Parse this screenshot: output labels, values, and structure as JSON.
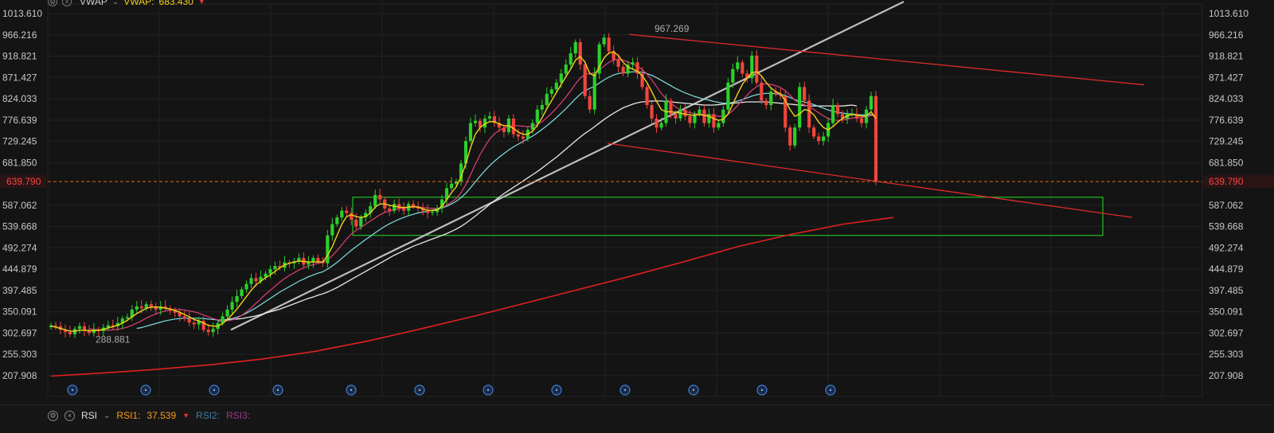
{
  "header": {
    "indicator_name": "VWAP",
    "vwap_label": "VWAP:",
    "vwap_value": "683.430"
  },
  "footer": {
    "indicator_name": "RSI",
    "rsi1_label": "RSI1:",
    "rsi1_value": "37.539",
    "rsi2_label": "RSI2:",
    "rsi3_label": "RSI3:"
  },
  "colors": {
    "background": "#141414",
    "grid": "#222222",
    "up_candle": "#2bd12b",
    "down_candle": "#f2453d",
    "ma_short": "#f2d21b",
    "ma_mid": "#e0407a",
    "ma_long": "#7fe0e0",
    "ma_longer": "#e8e8e8",
    "ma_slowest": "#e22020",
    "channel_line": "#e02a2a",
    "trendline": "#bdbdbd",
    "zone": "#22c022",
    "current_price_line": "#e06a1a"
  },
  "chart_data": {
    "type": "candlestick",
    "y_ticks": [
      "1013.610",
      "966.216",
      "918.821",
      "871.427",
      "824.033",
      "776.639",
      "729.245",
      "681.850",
      "587.062",
      "539.668",
      "492.274",
      "444.879",
      "397.485",
      "350.091",
      "302.697",
      "255.303",
      "207.908"
    ],
    "ylim": [
      207.908,
      1013.61
    ],
    "current_price": "639.790",
    "annotations": {
      "high_label": "967.269",
      "low_label": "288.881"
    },
    "event_marker_count": 12,
    "event_marker_icon": "clock-icon",
    "candle_closes": [
      320,
      318,
      310,
      305,
      300,
      312,
      318,
      308,
      303,
      311,
      307,
      315,
      320,
      318,
      325,
      335,
      338,
      355,
      362,
      358,
      367,
      360,
      355,
      362,
      358,
      352,
      348,
      340,
      335,
      326,
      322,
      330,
      310,
      305,
      312,
      325,
      340,
      355,
      372,
      385,
      400,
      412,
      425,
      418,
      428,
      435,
      445,
      452,
      448,
      460,
      458,
      462,
      470,
      455,
      460,
      470,
      462,
      458,
      520,
      545,
      560,
      575,
      570,
      555,
      540,
      560,
      570,
      585,
      610,
      600,
      580,
      575,
      590,
      580,
      575,
      590,
      585,
      580,
      575,
      570,
      572,
      580,
      600,
      625,
      635,
      640,
      680,
      730,
      770,
      775,
      760,
      780,
      785,
      770,
      760,
      750,
      780,
      745,
      740,
      735,
      755,
      770,
      800,
      810,
      835,
      845,
      860,
      880,
      900,
      925,
      950,
      900,
      830,
      800,
      880,
      945,
      960,
      930,
      910,
      895,
      880,
      900,
      905,
      880,
      850,
      810,
      780,
      760,
      770,
      820,
      790,
      780,
      800,
      785,
      770,
      790,
      800,
      770,
      790,
      760,
      770,
      800,
      860,
      890,
      905,
      880,
      870,
      920,
      860,
      820,
      810,
      840,
      835,
      830,
      760,
      720,
      760,
      850,
      820,
      760,
      740,
      730,
      740,
      770,
      810,
      790,
      780,
      790,
      790,
      780,
      770,
      800,
      830,
      640
    ],
    "ma_short": [
      318,
      316,
      313,
      310,
      307,
      307,
      309,
      309,
      308,
      308,
      309,
      311,
      314,
      317,
      320,
      325,
      331,
      339,
      346,
      352,
      358,
      360,
      361,
      360,
      358,
      356,
      353,
      349,
      344,
      339,
      333,
      330,
      325,
      320,
      318,
      318,
      324,
      333,
      344,
      356,
      370,
      384,
      398,
      410,
      418,
      426,
      432,
      440,
      448,
      454,
      458,
      461,
      463,
      462,
      461,
      461,
      461,
      461,
      475,
      495,
      520,
      545,
      562,
      566,
      562,
      560,
      562,
      570,
      583,
      590,
      590,
      587,
      585,
      583,
      582,
      583,
      584,
      583,
      579,
      576,
      575,
      577,
      585,
      600,
      615,
      628,
      650,
      680,
      715,
      745,
      760,
      768,
      773,
      773,
      768,
      764,
      764,
      758,
      750,
      745,
      745,
      752,
      765,
      782,
      802,
      820,
      838,
      856,
      873,
      890,
      910,
      918,
      905,
      880,
      875,
      895,
      915,
      926,
      928,
      920,
      905,
      895,
      890,
      885,
      875,
      860,
      840,
      818,
      800,
      795,
      795,
      794,
      792,
      790,
      788,
      787,
      789,
      787,
      785,
      780,
      776,
      778,
      790,
      812,
      835,
      856,
      870,
      882,
      884,
      875,
      860,
      848,
      840,
      835,
      820,
      800,
      785,
      790,
      800,
      798,
      788,
      772,
      760,
      755,
      762,
      772,
      780,
      786,
      789,
      788,
      785,
      786,
      795,
      780
    ],
    "ma_mid": [
      null,
      null,
      null,
      null,
      null,
      null,
      null,
      null,
      312,
      311,
      310,
      309,
      309,
      310,
      311,
      313,
      316,
      320,
      325,
      330,
      336,
      341,
      345,
      349,
      352,
      354,
      355,
      355,
      354,
      352,
      350,
      347,
      343,
      339,
      335,
      332,
      330,
      330,
      332,
      336,
      342,
      350,
      359,
      369,
      379,
      389,
      398,
      407,
      416,
      424,
      431,
      437,
      443,
      448,
      452,
      455,
      458,
      460,
      466,
      475,
      486,
      499,
      512,
      523,
      531,
      538,
      545,
      552,
      559,
      566,
      571,
      574,
      577,
      579,
      581,
      582,
      583,
      583,
      582,
      581,
      580,
      580,
      582,
      587,
      594,
      602,
      615,
      633,
      655,
      678,
      700,
      718,
      734,
      746,
      754,
      759,
      763,
      764,
      764,
      763,
      762,
      763,
      767,
      773,
      782,
      792,
      803,
      815,
      828,
      842,
      857,
      870,
      878,
      880,
      882,
      888,
      897,
      905,
      910,
      912,
      910,
      906,
      901,
      896,
      889,
      879,
      866,
      851,
      836,
      824,
      814,
      806,
      800,
      796,
      793,
      791,
      790,
      789,
      788,
      786,
      785,
      785,
      789,
      798,
      809,
      821,
      832,
      843,
      851,
      856,
      857,
      856,
      853,
      849,
      842,
      832,
      821,
      814,
      810,
      806,
      800,
      793,
      786,
      780,
      777,
      776,
      777,
      779,
      781,
      782,
      782,
      783,
      787,
      786
    ],
    "ma_long": [
      null,
      null,
      null,
      null,
      null,
      null,
      null,
      null,
      null,
      null,
      null,
      null,
      null,
      null,
      null,
      null,
      null,
      null,
      313,
      315,
      318,
      321,
      324,
      327,
      330,
      332,
      334,
      335,
      336,
      336,
      336,
      336,
      335,
      334,
      333,
      332,
      332,
      333,
      335,
      338,
      342,
      347,
      353,
      359,
      366,
      373,
      380,
      387,
      394,
      400,
      406,
      412,
      418,
      423,
      428,
      432,
      436,
      439,
      445,
      452,
      460,
      469,
      478,
      487,
      495,
      503,
      511,
      518,
      526,
      533,
      540,
      546,
      551,
      556,
      560,
      564,
      567,
      570,
      572,
      574,
      576,
      578,
      581,
      585,
      590,
      596,
      604,
      614,
      626,
      639,
      652,
      664,
      675,
      685,
      694,
      702,
      710,
      717,
      723,
      729,
      735,
      741,
      748,
      756,
      764,
      773,
      782,
      792,
      802,
      813,
      824,
      834,
      842,
      847,
      852,
      859,
      866,
      872,
      877,
      880,
      882,
      883,
      884,
      884,
      883,
      880,
      876,
      871,
      865,
      859,
      853,
      847,
      842,
      837,
      833,
      829,
      826,
      823,
      821,
      818,
      816,
      814,
      814,
      816,
      819,
      822,
      826,
      830,
      833,
      835,
      836,
      836,
      835,
      834,
      831,
      827,
      822,
      819,
      817,
      814,
      811,
      807,
      803,
      799,
      796,
      794,
      792,
      791,
      790,
      789,
      788,
      788,
      789,
      786
    ],
    "ma_longer": [
      null,
      null,
      null,
      null,
      null,
      null,
      null,
      null,
      null,
      null,
      null,
      null,
      null,
      null,
      null,
      null,
      null,
      null,
      null,
      null,
      null,
      null,
      null,
      null,
      null,
      null,
      null,
      null,
      null,
      null,
      null,
      null,
      null,
      null,
      null,
      330,
      331,
      332,
      333,
      334,
      335,
      337,
      339,
      341,
      344,
      347,
      350,
      353,
      356,
      360,
      364,
      368,
      372,
      376,
      380,
      383,
      387,
      390,
      394,
      399,
      404,
      410,
      416,
      422,
      428,
      434,
      440,
      446,
      452,
      458,
      464,
      470,
      476,
      481,
      486,
      491,
      496,
      500,
      504,
      508,
      512,
      516,
      520,
      524,
      529,
      534,
      540,
      547,
      555,
      563,
      572,
      580,
      589,
      597,
      605,
      613,
      620,
      627,
      634,
      641,
      648,
      655,
      662,
      670,
      678,
      686,
      694,
      703,
      712,
      721,
      730,
      739,
      747,
      754,
      762,
      770,
      778,
      785,
      792,
      798,
      804,
      808,
      812,
      815,
      817,
      818,
      819,
      819,
      819,
      818,
      817,
      816,
      815,
      814,
      813,
      812,
      811,
      810,
      810,
      810,
      811,
      812,
      813,
      814,
      815,
      816,
      817,
      817,
      817,
      817,
      817,
      816,
      815,
      814,
      813,
      812,
      811,
      810,
      809,
      808,
      808,
      808,
      808,
      808,
      808,
      808,
      808,
      809,
      810,
      808
    ],
    "ma_slowest": [
      [
        0,
        207
      ],
      [
        40,
        214
      ],
      [
        80,
        222
      ],
      [
        120,
        232
      ],
      [
        160,
        245
      ],
      [
        200,
        262
      ],
      [
        240,
        285
      ],
      [
        280,
        312
      ],
      [
        320,
        340
      ],
      [
        360,
        370
      ],
      [
        400,
        400
      ],
      [
        440,
        430
      ],
      [
        480,
        462
      ],
      [
        520,
        495
      ],
      [
        560,
        522
      ],
      [
        600,
        545
      ],
      [
        638,
        560
      ]
    ],
    "trendline": [
      [
        30,
        310
      ],
      [
        95,
        420
      ],
      [
        146,
        540
      ],
      [
        224,
        780
      ],
      [
        320,
        1040
      ]
    ],
    "channel_upper": [
      [
        95,
        967.269
      ],
      [
        232,
        855
      ]
    ],
    "channel_lower": [
      [
        94,
        725
      ],
      [
        230,
        560
      ]
    ],
    "zone": {
      "top": 605,
      "bottom": 520,
      "x_start": 60,
      "x_end": 230
    }
  }
}
